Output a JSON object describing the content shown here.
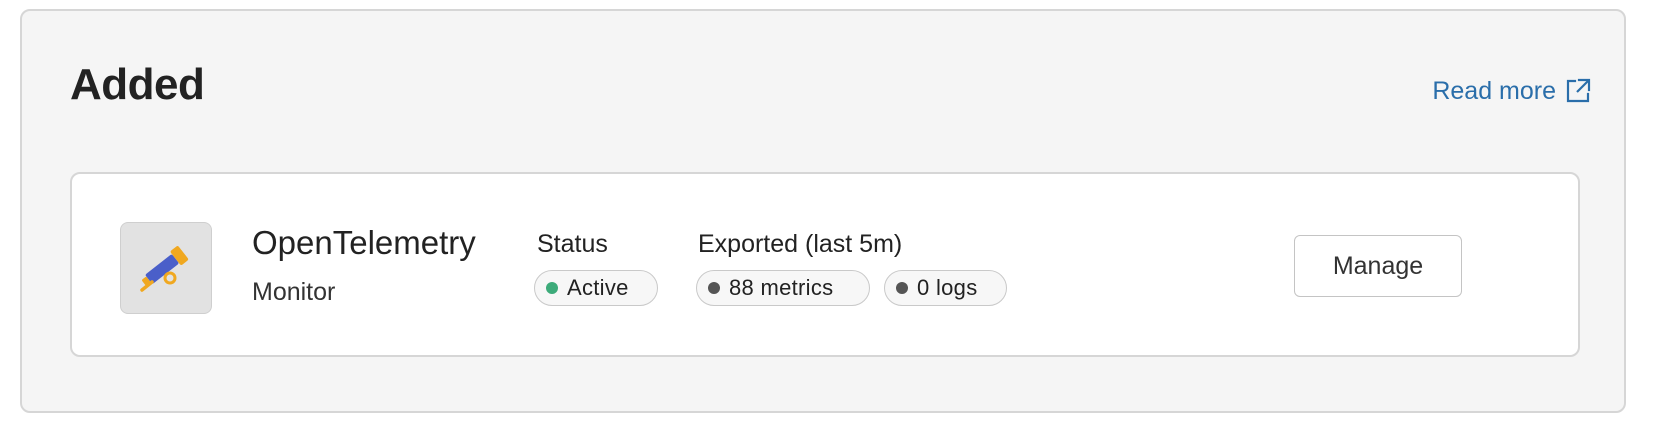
{
  "section": {
    "title": "Added",
    "read_more": {
      "label": "Read more",
      "icon": "external-link-icon",
      "color": "#2a6eaa"
    }
  },
  "integration": {
    "name": "OpenTelemetry",
    "category": "Monitor",
    "logo_icon": "telescope-icon",
    "logo_colors": {
      "body": "#4a5fc9",
      "accent": "#f0a820"
    },
    "status": {
      "label": "Status",
      "value": "Active",
      "dot_color": "#3dab7a"
    },
    "exported": {
      "label": "Exported (last 5m)",
      "metrics": "88 metrics",
      "logs": "0 logs",
      "dot_color": "#555555"
    },
    "manage_label": "Manage"
  }
}
